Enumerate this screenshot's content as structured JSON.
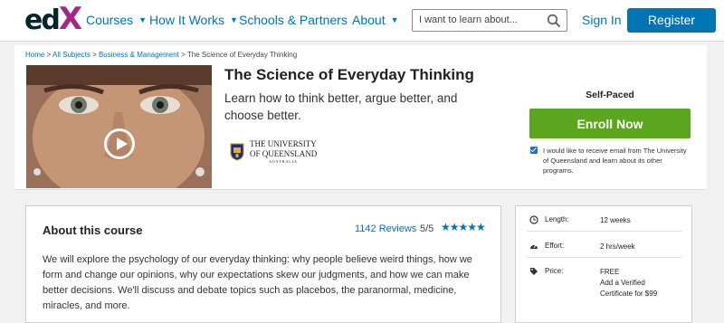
{
  "header": {
    "logo_e": "e",
    "logo_d": "d",
    "logo_x": "X",
    "nav": [
      {
        "label": "Courses",
        "has_dropdown": true
      },
      {
        "label": "How It Works",
        "has_dropdown": true
      },
      {
        "label": "Schools & Partners",
        "has_dropdown": false
      },
      {
        "label": "About",
        "has_dropdown": true
      }
    ],
    "search_placeholder": "I want to learn about...",
    "sign_in": "Sign In",
    "register": "Register",
    "icons": {
      "search": "search-icon",
      "caret": "chevron-down-icon"
    }
  },
  "breadcrumb": {
    "items": [
      "Home",
      "All Subjects",
      "Business & Management"
    ],
    "separator": ">",
    "current": "The Science of Everyday Thinking"
  },
  "course": {
    "title": "The Science of Everyday Thinking",
    "subtitle": "Learn how to think better, argue better, and choose better.",
    "university_line1": "The University",
    "university_line2": "Of Queensland",
    "university_line3": "AUSTRALIA",
    "pacing": "Self-Paced",
    "enroll": "Enroll Now",
    "optin_text": "I would like to receive email from The University of Queensland and learn about its other programs.",
    "optin_checked": true
  },
  "about": {
    "heading": "About this course",
    "reviews": "1142 Reviews",
    "rating": "5/5",
    "stars": "★★★★★",
    "star_count": 5,
    "description": "We will explore the psychology of our everyday thinking: why people believe weird things, how we form and change our opinions, why our expectations skew our judgments, and how we can make better decisions. We'll discuss and debate topics such as placebos, the paranormal, medicine, miracles, and more."
  },
  "facts": [
    {
      "icon": "clock-icon",
      "label": "Length:",
      "value": "12 weeks"
    },
    {
      "icon": "gauge-icon",
      "label": "Effort:",
      "value": "2 hrs/week"
    },
    {
      "icon": "tag-icon",
      "label": "Price:",
      "value": "FREE",
      "value2": "Add a Verified",
      "value3": "Certificate for $99"
    }
  ],
  "colors": {
    "brand_blue": "#0075b4",
    "enroll_green": "#5ca51e",
    "logo_magenta": "#a8248a",
    "logo_dark": "#02262b"
  }
}
